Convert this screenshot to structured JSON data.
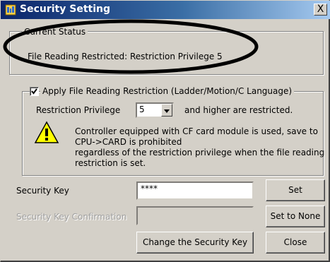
{
  "window": {
    "title": "Security Setting",
    "close_glyph": "X"
  },
  "status_group": {
    "legend": "Current Status",
    "text": "File Reading Restricted: Restriction Privilege 5"
  },
  "restriction_group": {
    "checkbox_checked": true,
    "checkbox_label": "Apply File Reading Restriction (Ladder/Motion/C Language)",
    "privilege_label": "Restriction Privilege",
    "privilege_value": "5",
    "privilege_suffix": "and higher are restricted.",
    "warning_lines": [
      "Controller equipped with CF card module is used, save to",
      "CPU->CARD is prohibited",
      "regardless of the restriction privilege when the file reading",
      "restriction is set."
    ]
  },
  "security_key": {
    "label": "Security Key",
    "value": "****",
    "set_button": "Set"
  },
  "confirmation": {
    "label": "Security Key Confirmation",
    "value": "",
    "set_none_button": "Set to None"
  },
  "footer": {
    "change_button": "Change the Security Key",
    "close_button": "Close"
  },
  "colors": {
    "dialog_face": "#d4d0c8",
    "title_start": "#0a246a",
    "title_end": "#a6caf0",
    "annotation_ellipse": "#000000",
    "warning_yellow": "#ffff00"
  },
  "icons": {
    "title": "key-lock-icon",
    "warning": "warning-icon",
    "dropdown": "chevron-down-icon"
  }
}
